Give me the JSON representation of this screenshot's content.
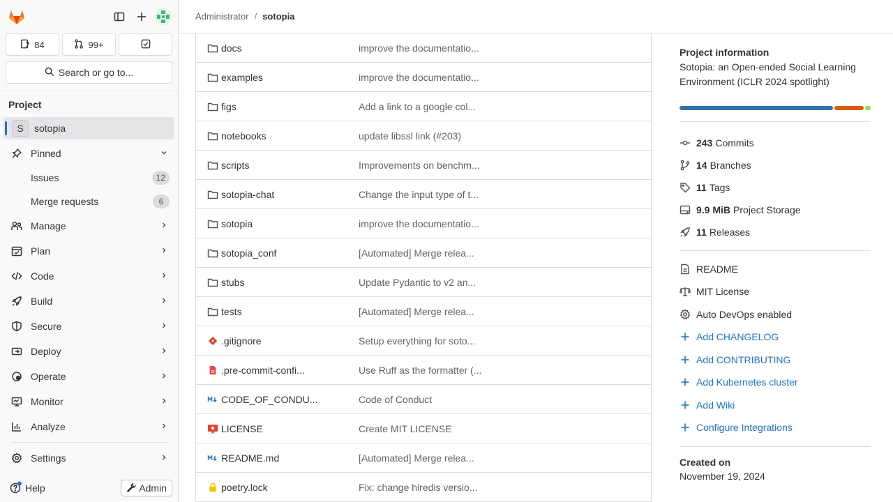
{
  "sidebar": {
    "counts": {
      "issues": "84",
      "merge_requests": "99+"
    },
    "search_label": "Search or go to...",
    "section_title": "Project",
    "project": {
      "initial": "S",
      "name": "sotopia"
    },
    "pinned": {
      "label": "Pinned",
      "items": [
        {
          "label": "Issues",
          "count": "12"
        },
        {
          "label": "Merge requests",
          "count": "6"
        }
      ]
    },
    "nav": [
      {
        "label": "Manage",
        "icon": "users-icon"
      },
      {
        "label": "Plan",
        "icon": "calendar-icon"
      },
      {
        "label": "Code",
        "icon": "code-icon"
      },
      {
        "label": "Build",
        "icon": "rocket-icon"
      },
      {
        "label": "Secure",
        "icon": "shield-icon"
      },
      {
        "label": "Deploy",
        "icon": "deploy-icon"
      },
      {
        "label": "Operate",
        "icon": "cloud-gear-icon"
      },
      {
        "label": "Monitor",
        "icon": "monitor-icon"
      },
      {
        "label": "Analyze",
        "icon": "chart-icon"
      }
    ],
    "settings_label": "Settings",
    "help_label": "Help",
    "admin_label": "Admin"
  },
  "breadcrumb": {
    "root": "Administrator",
    "separator": "/",
    "current": "sotopia"
  },
  "files": [
    {
      "name": "docs",
      "type": "folder",
      "message": "improve the documentatio..."
    },
    {
      "name": "examples",
      "type": "folder",
      "message": "improve the documentatio..."
    },
    {
      "name": "figs",
      "type": "folder",
      "message": "Add a link to a google col..."
    },
    {
      "name": "notebooks",
      "type": "folder",
      "message": "update libssl link (#203)"
    },
    {
      "name": "scripts",
      "type": "folder",
      "message": "Improvements on benchm..."
    },
    {
      "name": "sotopia-chat",
      "type": "folder",
      "message": "Change the input type of t..."
    },
    {
      "name": "sotopia",
      "type": "folder",
      "message": "improve the documentatio..."
    },
    {
      "name": "sotopia_conf",
      "type": "folder",
      "message": "[Automated] Merge relea..."
    },
    {
      "name": "stubs",
      "type": "folder",
      "message": "Update Pydantic to v2 an..."
    },
    {
      "name": "tests",
      "type": "folder",
      "message": "[Automated] Merge relea..."
    },
    {
      "name": ".gitignore",
      "type": "git",
      "message": "Setup everything for soto..."
    },
    {
      "name": ".pre-commit-confi...",
      "type": "yaml",
      "message": "Use Ruff as the formatter (..."
    },
    {
      "name": "CODE_OF_CONDU...",
      "type": "markdown",
      "message": "Code of Conduct"
    },
    {
      "name": "LICENSE",
      "type": "license",
      "message": "Create MIT LICENSE"
    },
    {
      "name": "README.md",
      "type": "markdown",
      "message": "[Automated] Merge relea..."
    },
    {
      "name": "poetry.lock",
      "type": "lock",
      "message": "Fix: change hiredis versio..."
    }
  ],
  "project_info": {
    "title": "Project information",
    "description": "Sotopia: an Open-ended Social Learning Environment (ICLR 2024 spotlight)",
    "languages": [
      {
        "share": 0.815,
        "color": "#3572a5"
      },
      {
        "share": 0.155,
        "color": "#da5b0b"
      },
      {
        "share": 0.03,
        "color": "#89e051"
      }
    ],
    "stats": [
      {
        "value": "243",
        "label": "Commits",
        "icon": "commit-icon"
      },
      {
        "value": "14",
        "label": "Branches",
        "icon": "branch-icon"
      },
      {
        "value": "11",
        "label": "Tags",
        "icon": "tag-icon"
      },
      {
        "value": "9.9 MiB",
        "label": "Project Storage",
        "icon": "storage-icon"
      },
      {
        "value": "11",
        "label": "Releases",
        "icon": "rocket-icon"
      }
    ],
    "links": [
      {
        "label": "README",
        "icon": "document-icon",
        "style": "plain"
      },
      {
        "label": "MIT License",
        "icon": "scale-icon",
        "style": "plain"
      },
      {
        "label": "Auto DevOps enabled",
        "icon": "gear-icon",
        "style": "plain"
      },
      {
        "label": "Add CHANGELOG",
        "icon": "plus-icon",
        "style": "link"
      },
      {
        "label": "Add CONTRIBUTING",
        "icon": "plus-icon",
        "style": "link"
      },
      {
        "label": "Add Kubernetes cluster",
        "icon": "plus-icon",
        "style": "link"
      },
      {
        "label": "Add Wiki",
        "icon": "plus-icon",
        "style": "link"
      },
      {
        "label": "Configure Integrations",
        "icon": "plus-icon",
        "style": "link"
      }
    ],
    "created_title": "Created on",
    "created_date": "November 19, 2024"
  }
}
